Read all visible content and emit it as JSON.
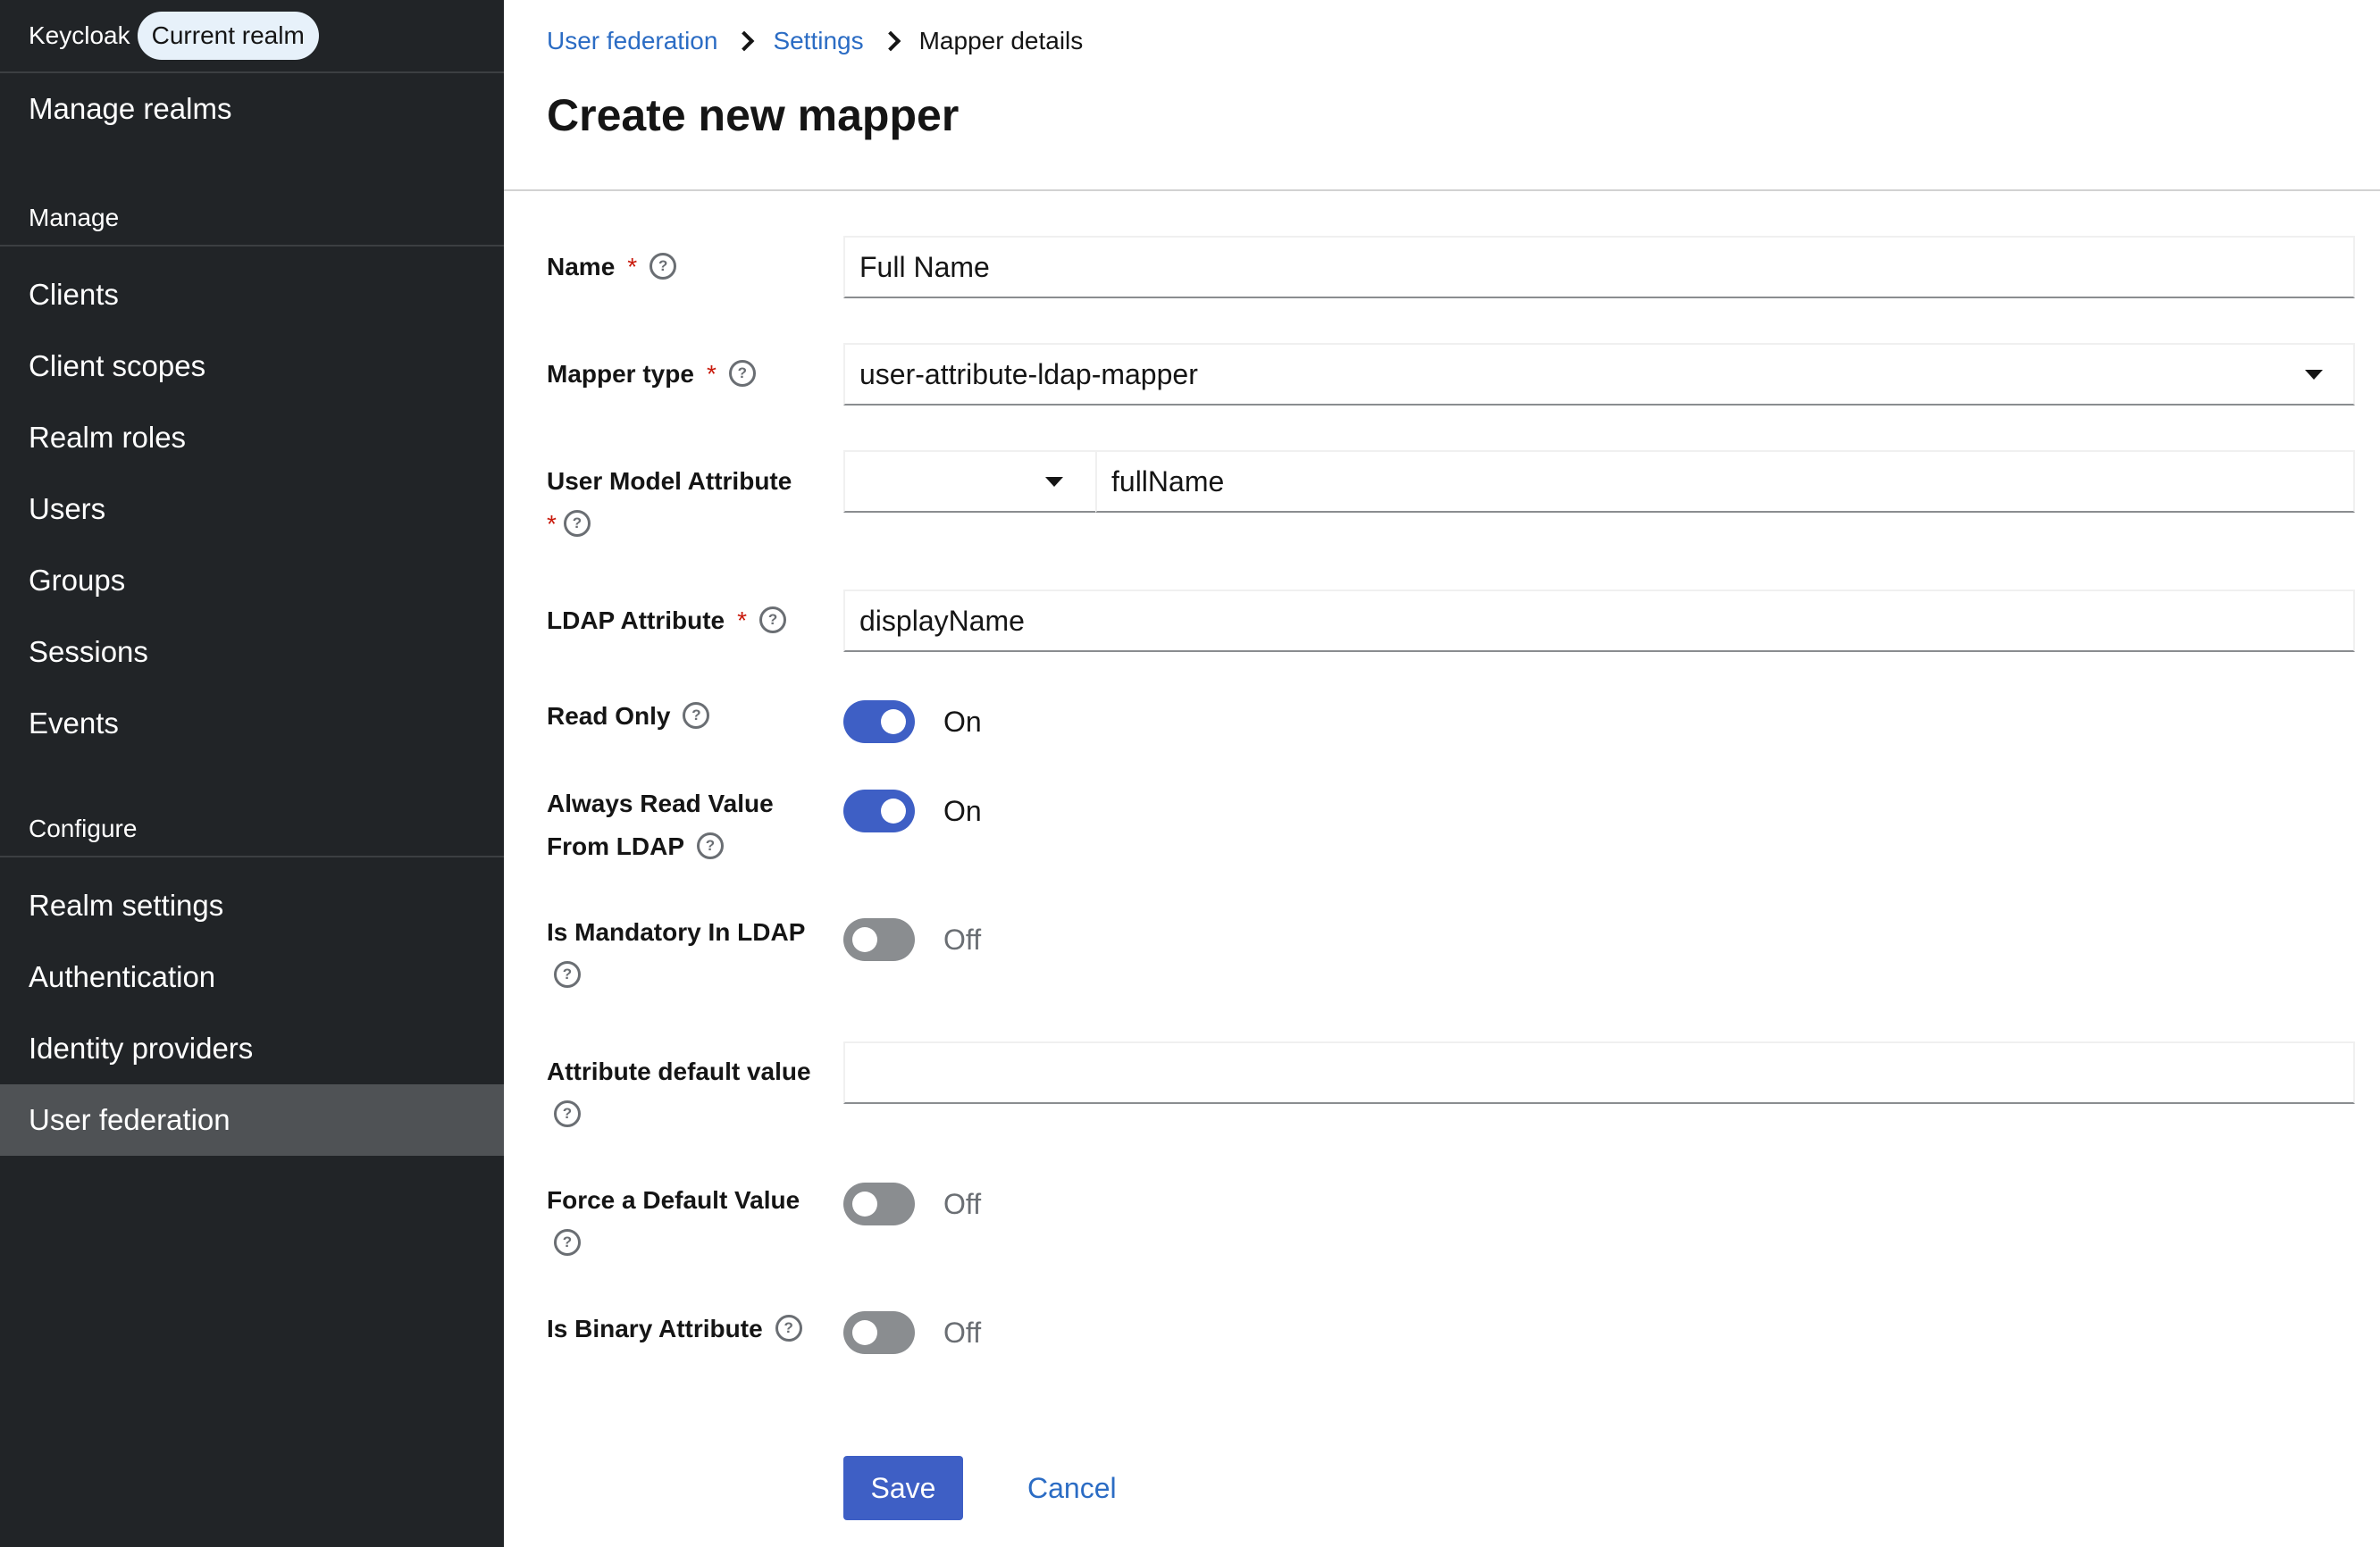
{
  "sidebar": {
    "brand": "Keycloak",
    "realm_badge": "Current realm",
    "manage_realms": "Manage realms",
    "manage_section": "Manage",
    "manage_items": [
      "Clients",
      "Client scopes",
      "Realm roles",
      "Users",
      "Groups",
      "Sessions",
      "Events"
    ],
    "configure_section": "Configure",
    "configure_items": [
      "Realm settings",
      "Authentication",
      "Identity providers",
      "User federation"
    ],
    "active_item": "User federation"
  },
  "breadcrumb": {
    "items": [
      "User federation",
      "Settings"
    ],
    "current": "Mapper details"
  },
  "page": {
    "title": "Create new mapper"
  },
  "form": {
    "name": {
      "label": "Name",
      "value": "Full Name"
    },
    "mapper_type": {
      "label": "Mapper type",
      "value": "user-attribute-ldap-mapper"
    },
    "user_model_attribute": {
      "label": "User Model Attribute",
      "select_value": "",
      "value": "fullName"
    },
    "ldap_attribute": {
      "label": "LDAP Attribute",
      "value": "displayName"
    },
    "read_only": {
      "label": "Read Only",
      "state": "On",
      "on": true
    },
    "always_read": {
      "label_line1": "Always Read Value",
      "label_line2": "From LDAP",
      "state": "On",
      "on": true
    },
    "is_mandatory": {
      "label": "Is Mandatory In LDAP",
      "state": "Off",
      "on": false
    },
    "attribute_default": {
      "label": "Attribute default value",
      "value": ""
    },
    "force_default": {
      "label": "Force a Default Value",
      "state": "Off",
      "on": false
    },
    "is_binary": {
      "label": "Is Binary Attribute",
      "state": "Off",
      "on": false
    },
    "required_marker": "*",
    "help_glyph": "?"
  },
  "actions": {
    "save": "Save",
    "cancel": "Cancel"
  },
  "colors": {
    "accent": "#3e5fc5",
    "link": "#2b6cc4",
    "sidebar_bg": "#212427",
    "required": "#c9190b"
  }
}
